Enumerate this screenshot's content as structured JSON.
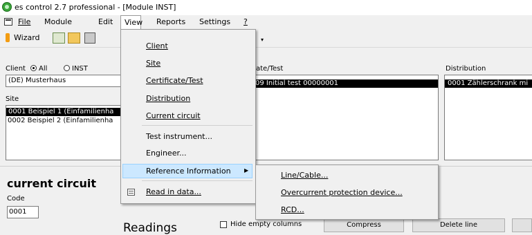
{
  "window": {
    "title": "es control 2.7 professional - [Module INST]"
  },
  "menubar": {
    "items": [
      "File",
      "Module",
      "Edit",
      "View",
      "Reports",
      "Settings",
      "?"
    ]
  },
  "toolbar": {
    "wizard_label": "Wizard"
  },
  "client": {
    "label": "Client",
    "radio_all": "All",
    "radio_inst": "INST",
    "value": "(DE) Musterhaus"
  },
  "site": {
    "label": "Site",
    "rows": [
      "0001  Beispiel 1 (Einfamilienha",
      "0002  Beispiel 2 (Einfamilienha"
    ]
  },
  "certificate": {
    "label_fragment": "ate/Test",
    "row": "09 Initial test 00000001"
  },
  "distribution": {
    "label": "Distribution",
    "row": "0001  Zählerschrank mi"
  },
  "current_circuit": {
    "heading": "current circuit",
    "code_label": "Code",
    "code_value": "0001"
  },
  "readings": {
    "heading": "Readings",
    "hide_empty_label": "Hide empty columns",
    "compress_label": "Compress",
    "delete_line_label": "Delete line"
  },
  "view_menu": {
    "items": [
      "Client",
      "Site",
      "Certificate/Test",
      "Distribution",
      "Current circuit",
      "Test instrument...",
      "Engineer...",
      "Reference Information",
      "Read in data..."
    ]
  },
  "reference_submenu": {
    "items": [
      "Line/Cable...",
      "Overcurrent protection device...",
      "RCD..."
    ]
  },
  "colors": {
    "menu_highlight": "#cce8ff",
    "selection": "#000000",
    "app_icon": "#3aa63a"
  }
}
